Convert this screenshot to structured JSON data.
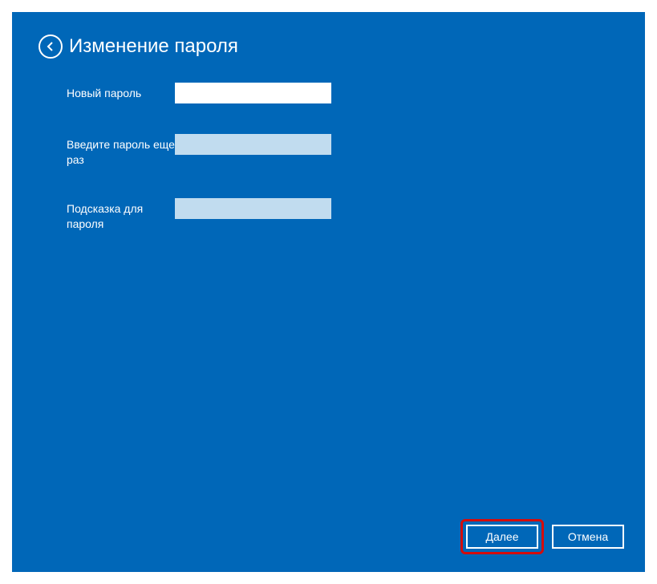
{
  "header": {
    "title": "Изменение пароля"
  },
  "form": {
    "new_password": {
      "label": "Новый пароль",
      "value": ""
    },
    "confirm_password": {
      "label": "Введите пароль еще раз",
      "value": ""
    },
    "hint": {
      "label": "Подсказка для пароля",
      "value": ""
    }
  },
  "footer": {
    "next_label": "Далее",
    "cancel_label": "Отмена"
  }
}
